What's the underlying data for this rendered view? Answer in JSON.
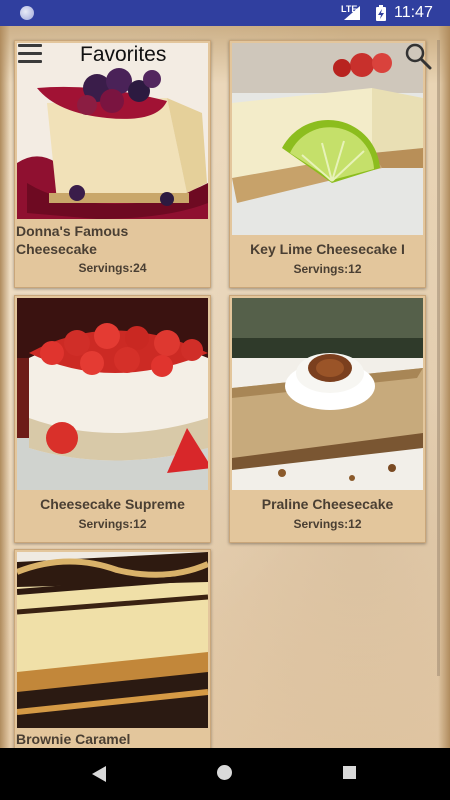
{
  "status_bar": {
    "time": "11:47",
    "network": "LTE"
  },
  "toolbar": {
    "title": "Favorites"
  },
  "recipes": [
    {
      "name": "Donna's Famous Cheesecake",
      "servings": "Servings:24"
    },
    {
      "name": "Key Lime Cheesecake I",
      "servings": "Servings:12"
    },
    {
      "name": "Cheesecake Supreme",
      "servings": "Servings:12"
    },
    {
      "name": "Praline Cheesecake",
      "servings": "Servings:12"
    },
    {
      "name": "Brownie Caramel",
      "servings": ""
    }
  ],
  "icons": {
    "menu": "hamburger-menu-icon",
    "search": "magnifier-search-icon",
    "back": "triangle-back-icon",
    "home": "circle-home-icon",
    "recent": "square-recent-apps-icon"
  },
  "colors": {
    "status_bar": "#303f9f",
    "card_bg": "#e3c69c",
    "text": "#4a3f33"
  }
}
